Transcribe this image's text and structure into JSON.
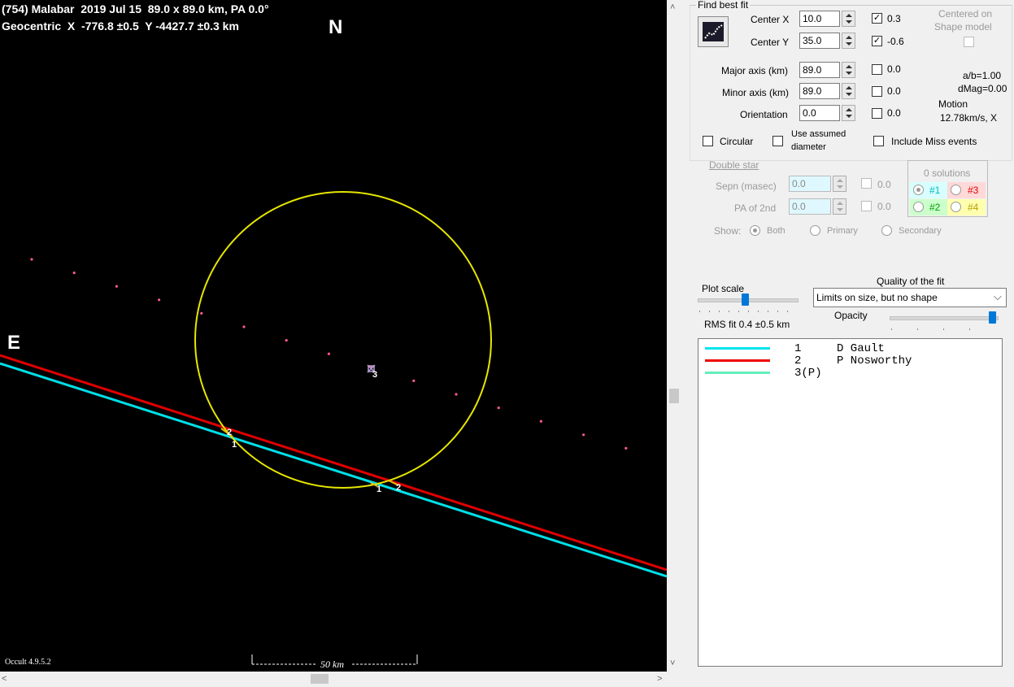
{
  "plot": {
    "title_line1": "(754) Malabar  2019 Jul 15  89.0 x 89.0 km, PA 0.0°",
    "title_line2": "Geocentric  X  -776.8 ±0.5  Y -4427.7 ±0.3 km",
    "north_label": "N",
    "east_label": "E",
    "version_label": "Occult 4.9.5.2",
    "scale_label": "50 km",
    "chord_labels": {
      "a1": "1",
      "a2": "2",
      "b1": "1",
      "b2": "2",
      "center": "3"
    }
  },
  "fit": {
    "group_label": "Find best fit",
    "center_x_label": "Center X",
    "center_x_value": "10.0",
    "center_x_check": "0.3",
    "center_y_label": "Center Y",
    "center_y_value": "35.0",
    "center_y_check": "-0.6",
    "major_label": "Major axis (km)",
    "major_value": "89.0",
    "major_check": "0.0",
    "minor_label": "Minor axis (km)",
    "minor_value": "89.0",
    "minor_check": "0.0",
    "orientation_label": "Orientation",
    "orientation_value": "0.0",
    "orientation_check": "0.0",
    "centered_label_1": "Centered on",
    "centered_label_2": "Shape model",
    "ab_ratio": "a/b=1.00",
    "dmag": "dMag=0.00",
    "motion_label": "Motion",
    "motion_value": "12.78km/s, X",
    "circular_label": "Circular",
    "use_assumed_1": "Use assumed",
    "use_assumed_2": "diameter",
    "include_miss_label": "Include Miss events"
  },
  "double_star": {
    "title": "Double star",
    "sepn_label": "Sepn (masec)",
    "sepn_value": "0.0",
    "sepn_check": "0.0",
    "pa_label": "PA of 2nd",
    "pa_value": "0.0",
    "pa_check": "0.0",
    "show_label": "Show:",
    "show_both": "Both",
    "show_primary": "Primary",
    "show_secondary": "Secondary",
    "solutions_label": "0 solutions",
    "sol1": "#1",
    "sol2": "#2",
    "sol3": "#3",
    "sol4": "#4"
  },
  "controls": {
    "plot_scale_label": "Plot scale",
    "quality_label": "Quality of the fit",
    "quality_value": "Limits on size, but no shape",
    "opacity_label": "Opacity",
    "rms_label": "RMS fit 0.4 ±0.5 km"
  },
  "legend": [
    {
      "number": "1",
      "text": "D Gault",
      "color": "#00e5ee"
    },
    {
      "number": "2",
      "text": "P Nosworthy",
      "color": "#ee0000"
    },
    {
      "number": "3(P)",
      "text": "",
      "color": "#66eebb"
    }
  ],
  "colors": {
    "ellipse": "#e6e600",
    "chord1": "#00e0e8",
    "chord2": "#e00000",
    "path_dots": "#ff5a8a",
    "sol1_bg": "#d8ffff",
    "sol2_bg": "#ccffcc",
    "sol3_bg": "#ffd8d8",
    "sol4_bg": "#ffffb0"
  }
}
